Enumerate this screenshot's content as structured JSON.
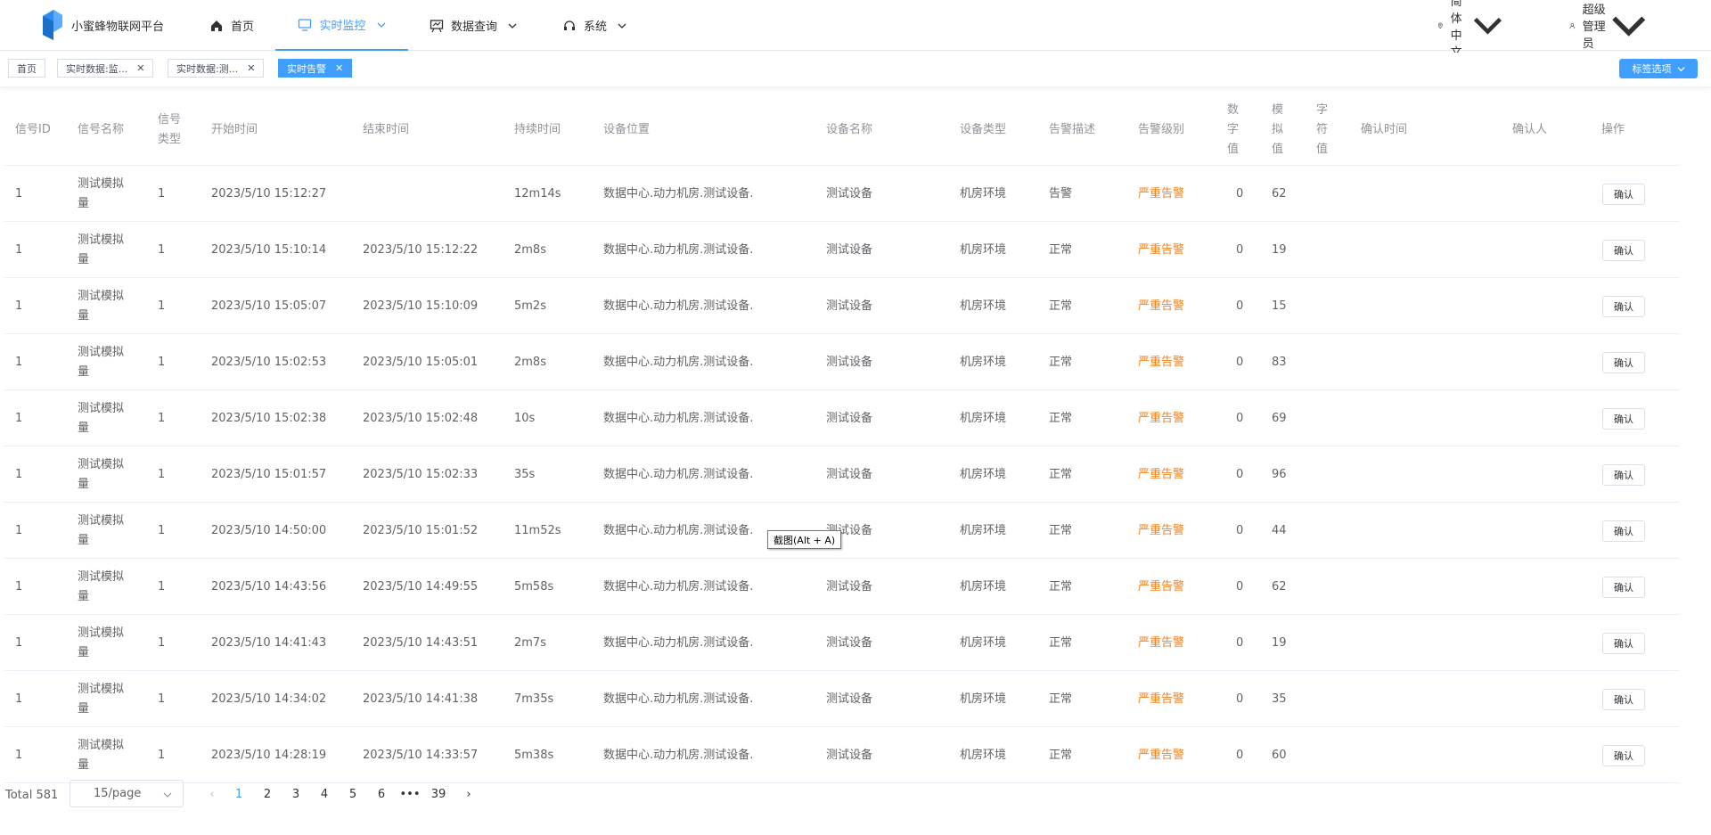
{
  "app": {
    "title": "小蜜蜂物联网平台"
  },
  "nav": {
    "home": "首页",
    "monitor": "实时监控",
    "query": "数据查询",
    "system": "系统",
    "language": "简体中文",
    "user": "超级管理员"
  },
  "tags": [
    "首页",
    "实时数据:监...",
    "实时数据:测...",
    "实时告警"
  ],
  "tag_options": "标签选项",
  "columns": {
    "signal_id": "信号ID",
    "signal_name": "信号名称",
    "signal_type": [
      "信号",
      "类型"
    ],
    "start_time": "开始时间",
    "end_time": "结束时间",
    "duration": "持续时间",
    "location": "设备位置",
    "device_name": "设备名称",
    "device_type": "设备类型",
    "alarm_desc": "告警描述",
    "alarm_level": "告警级别",
    "digital": [
      "数",
      "字",
      "值"
    ],
    "analog": [
      "模",
      "拟",
      "值"
    ],
    "string": [
      "字",
      "符",
      "值"
    ],
    "confirm_time": "确认时间",
    "confirmer": "确认人",
    "action": "操作"
  },
  "rows": [
    {
      "id": "1",
      "name1": "测试模拟",
      "name2": "量",
      "type": "1",
      "start": "2023/5/10 15:12:27",
      "end": "",
      "duration": "12m14s",
      "location": "数据中心.动力机房.测试设备.",
      "device": "测试设备",
      "dtype": "机房环境",
      "desc": "告警",
      "level": "严重告警",
      "digital": "0",
      "analog": "62",
      "confirm": "确认"
    },
    {
      "id": "1",
      "name1": "测试模拟",
      "name2": "量",
      "type": "1",
      "start": "2023/5/10 15:10:14",
      "end": "2023/5/10 15:12:22",
      "duration": "2m8s",
      "location": "数据中心.动力机房.测试设备.",
      "device": "测试设备",
      "dtype": "机房环境",
      "desc": "正常",
      "level": "严重告警",
      "digital": "0",
      "analog": "19",
      "confirm": "确认"
    },
    {
      "id": "1",
      "name1": "测试模拟",
      "name2": "量",
      "type": "1",
      "start": "2023/5/10 15:05:07",
      "end": "2023/5/10 15:10:09",
      "duration": "5m2s",
      "location": "数据中心.动力机房.测试设备.",
      "device": "测试设备",
      "dtype": "机房环境",
      "desc": "正常",
      "level": "严重告警",
      "digital": "0",
      "analog": "15",
      "confirm": "确认"
    },
    {
      "id": "1",
      "name1": "测试模拟",
      "name2": "量",
      "type": "1",
      "start": "2023/5/10 15:02:53",
      "end": "2023/5/10 15:05:01",
      "duration": "2m8s",
      "location": "数据中心.动力机房.测试设备.",
      "device": "测试设备",
      "dtype": "机房环境",
      "desc": "正常",
      "level": "严重告警",
      "digital": "0",
      "analog": "83",
      "confirm": "确认"
    },
    {
      "id": "1",
      "name1": "测试模拟",
      "name2": "量",
      "type": "1",
      "start": "2023/5/10 15:02:38",
      "end": "2023/5/10 15:02:48",
      "duration": "10s",
      "location": "数据中心.动力机房.测试设备.",
      "device": "测试设备",
      "dtype": "机房环境",
      "desc": "正常",
      "level": "严重告警",
      "digital": "0",
      "analog": "69",
      "confirm": "确认"
    },
    {
      "id": "1",
      "name1": "测试模拟",
      "name2": "量",
      "type": "1",
      "start": "2023/5/10 15:01:57",
      "end": "2023/5/10 15:02:33",
      "duration": "35s",
      "location": "数据中心.动力机房.测试设备.",
      "device": "测试设备",
      "dtype": "机房环境",
      "desc": "正常",
      "level": "严重告警",
      "digital": "0",
      "analog": "96",
      "confirm": "确认"
    },
    {
      "id": "1",
      "name1": "测试模拟",
      "name2": "量",
      "type": "1",
      "start": "2023/5/10 14:50:00",
      "end": "2023/5/10 15:01:52",
      "duration": "11m52s",
      "location": "数据中心.动力机房.测试设备.",
      "device": "测试设备",
      "dtype": "机房环境",
      "desc": "正常",
      "level": "严重告警",
      "digital": "0",
      "analog": "44",
      "confirm": "确认"
    },
    {
      "id": "1",
      "name1": "测试模拟",
      "name2": "量",
      "type": "1",
      "start": "2023/5/10 14:43:56",
      "end": "2023/5/10 14:49:55",
      "duration": "5m58s",
      "location": "数据中心.动力机房.测试设备.",
      "device": "测试设备",
      "dtype": "机房环境",
      "desc": "正常",
      "level": "严重告警",
      "digital": "0",
      "analog": "62",
      "confirm": "确认"
    },
    {
      "id": "1",
      "name1": "测试模拟",
      "name2": "量",
      "type": "1",
      "start": "2023/5/10 14:41:43",
      "end": "2023/5/10 14:43:51",
      "duration": "2m7s",
      "location": "数据中心.动力机房.测试设备.",
      "device": "测试设备",
      "dtype": "机房环境",
      "desc": "正常",
      "level": "严重告警",
      "digital": "0",
      "analog": "19",
      "confirm": "确认"
    },
    {
      "id": "1",
      "name1": "测试模拟",
      "name2": "量",
      "type": "1",
      "start": "2023/5/10 14:34:02",
      "end": "2023/5/10 14:41:38",
      "duration": "7m35s",
      "location": "数据中心.动力机房.测试设备.",
      "device": "测试设备",
      "dtype": "机房环境",
      "desc": "正常",
      "level": "严重告警",
      "digital": "0",
      "analog": "35",
      "confirm": "确认"
    },
    {
      "id": "1",
      "name1": "测试模拟",
      "name2": "量",
      "type": "1",
      "start": "2023/5/10 14:28:19",
      "end": "2023/5/10 14:33:57",
      "duration": "5m38s",
      "location": "数据中心.动力机房.测试设备.",
      "device": "测试设备",
      "dtype": "机房环境",
      "desc": "正常",
      "level": "严重告警",
      "digital": "0",
      "analog": "60",
      "confirm": "确认"
    }
  ],
  "pager": {
    "total": "Total 581",
    "size": "15/page",
    "pages": [
      "1",
      "2",
      "3",
      "4",
      "5",
      "6",
      "•••",
      "39"
    ],
    "current": "1"
  },
  "tooltip": "截图(Alt + A)",
  "colors": {
    "accent": "#409eff",
    "level": "#f5821f"
  }
}
